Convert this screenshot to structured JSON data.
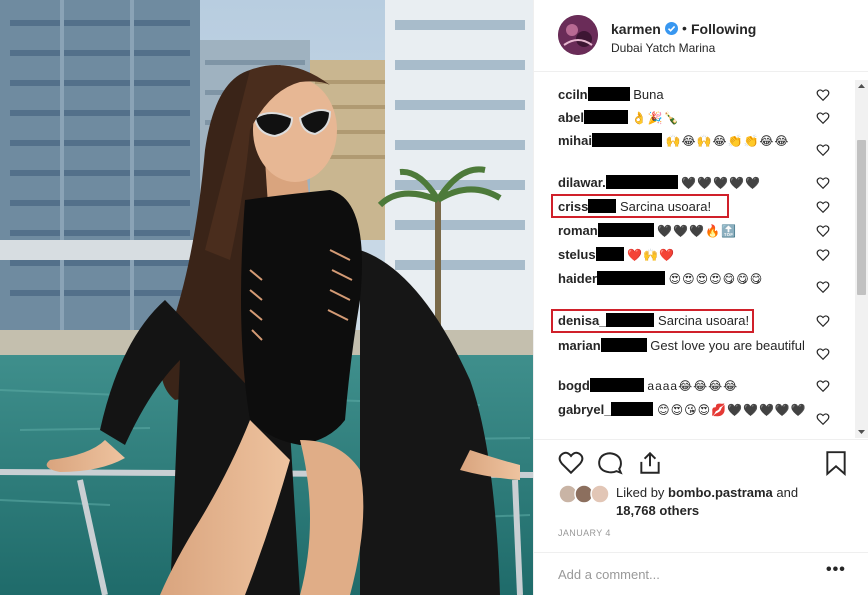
{
  "post": {
    "username": "karmen",
    "follow_separator": "•",
    "follow_label": "Following",
    "location": "Dubai Yatch Marina",
    "date": "JANUARY 4"
  },
  "comments": [
    {
      "name": "cciln",
      "text": "Buna"
    },
    {
      "name": "abel",
      "text": "👌🎉🍾"
    },
    {
      "name": "mihai",
      "text": "🙌😂🙌😂👏👏😂😂"
    },
    {
      "name": "dilawar.",
      "text": "🖤🖤🖤🖤🖤"
    },
    {
      "name": "criss",
      "text": "Sarcina usoara!"
    },
    {
      "name": "roman",
      "text": "🖤🖤🖤🔥🔝"
    },
    {
      "name": "stelus",
      "text": "❤️🙌❤️"
    },
    {
      "name": "haider",
      "text": "😍😍😍😍😋😋😋"
    },
    {
      "name": "denisa_",
      "text": "Sarcina usoara!"
    },
    {
      "name": "marian",
      "text": "Gest love you are beautiful"
    },
    {
      "name": "bogd",
      "text": "aaaa😂😂😂😂"
    },
    {
      "name": "gabryel_",
      "text": "😊😍😘😍💋🖤🖤🖤🖤🖤"
    }
  ],
  "likes": {
    "prefix": "Liked by",
    "user": "bombo.pastrama",
    "joiner": "and",
    "count": "18,768 others"
  },
  "add_comment": {
    "placeholder": "Add a comment...",
    "more": "•••"
  },
  "colors": {
    "highlight": "#d0202a",
    "verified": "#3897f0",
    "muted": "#999999"
  },
  "icons": [
    "verified-badge-icon",
    "heart-icon",
    "comment-icon",
    "share-icon",
    "bookmark-icon",
    "more-options-icon"
  ]
}
